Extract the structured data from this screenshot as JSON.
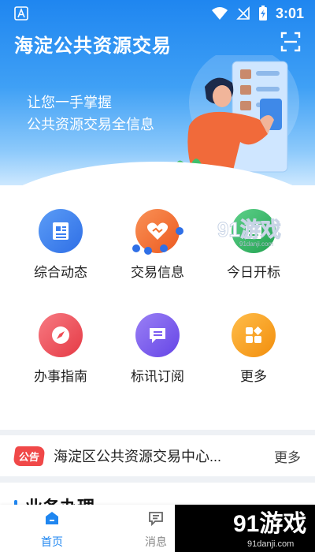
{
  "status_bar": {
    "time": "3:01"
  },
  "header": {
    "title": "海淀公共资源交易",
    "scan_icon": "scan-icon"
  },
  "hero": {
    "slogan_line1": "让您一手掌握",
    "slogan_line2": "公共资源交易全信息"
  },
  "grid": [
    {
      "label": "综合动态",
      "icon": "newspaper-icon",
      "color": "#3b7ff1"
    },
    {
      "label": "交易信息",
      "icon": "handshake-heart-icon",
      "color": "#f2702c"
    },
    {
      "label": "今日开标",
      "icon": "calendar-icon",
      "color": "#2fb35e"
    },
    {
      "label": "办事指南",
      "icon": "compass-icon",
      "color": "#ef4c55"
    },
    {
      "label": "标讯订阅",
      "icon": "message-icon",
      "color": "#7b5cf0"
    },
    {
      "label": "更多",
      "icon": "grid-icon",
      "color": "#f6a11a"
    }
  ],
  "notice": {
    "badge": "公告",
    "text": "海淀区公共资源交易中心...",
    "more": "更多"
  },
  "section": {
    "title": "业务办理"
  },
  "tabs": [
    {
      "label": "首页",
      "icon": "home-icon",
      "active": true
    },
    {
      "label": "消息",
      "icon": "message-icon",
      "active": false
    }
  ],
  "watermark": {
    "brand": "91游戏",
    "url": "91danji.com",
    "small": "91danji.com"
  },
  "colors": {
    "primary": "#1f86f0",
    "notice_red": "#f04848"
  }
}
